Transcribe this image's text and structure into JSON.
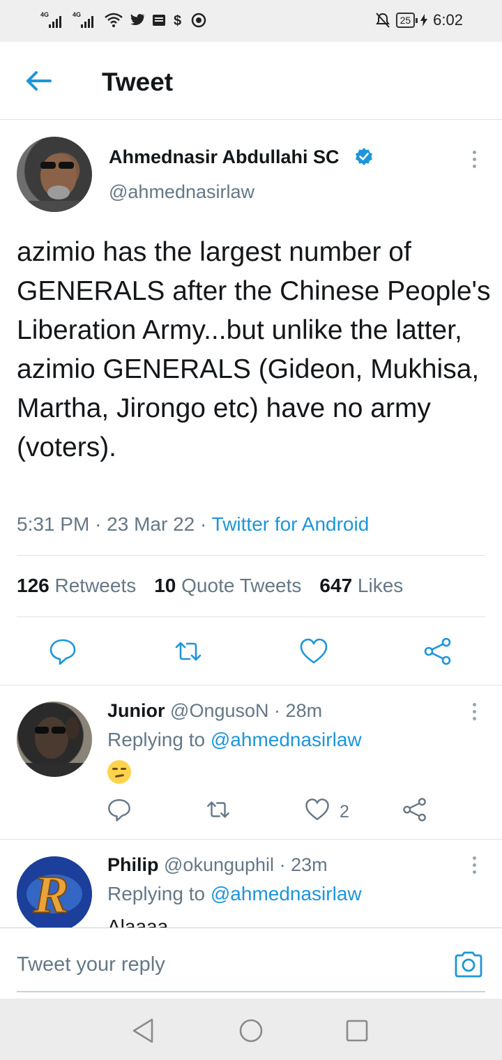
{
  "status_bar": {
    "network_1": "4G",
    "network_2": "4G",
    "battery": "25",
    "time": "6:02",
    "icons": [
      "signal-icon",
      "signal-icon",
      "wifi-icon",
      "twitter-bird-icon",
      "news-icon",
      "dollar-icon",
      "shield-icon",
      "mute-bell-icon",
      "battery-icon",
      "charging-icon"
    ]
  },
  "header": {
    "title": "Tweet"
  },
  "tweet": {
    "author_name": "Ahmednasir Abdullahi SC",
    "handle": "@ahmednasirlaw",
    "text": "azimio has the largest number of GENERALS after the Chinese People's Liberation Army...but unlike the latter, azimio GENERALS (Gideon, Mukhisa, Martha, Jirongo etc) have no army (voters).",
    "time": "5:31 PM",
    "date": "23 Mar 22",
    "source": "Twitter for Android",
    "stats": {
      "retweets_count": "126",
      "retweets_label": "Retweets",
      "quotes_count": "10",
      "quotes_label": "Quote Tweets",
      "likes_count": "647",
      "likes_label": "Likes"
    }
  },
  "replies": [
    {
      "name": "Junior",
      "handle": "@OngusoN",
      "time": "28m",
      "replying_label": "Replying to",
      "replying_to": "@ahmednasirlaw",
      "likes": "2"
    },
    {
      "name": "Philip",
      "handle": "@okunguphil",
      "time": "23m",
      "replying_label": "Replying to",
      "replying_to": "@ahmednasirlaw",
      "text_partial": "Alaaaa"
    }
  ],
  "composer": {
    "placeholder": "Tweet your reply"
  },
  "colors": {
    "accent": "#1d95d9",
    "secondary_text": "#657786",
    "primary_text": "#14171a",
    "divider": "#dfe3e7"
  }
}
